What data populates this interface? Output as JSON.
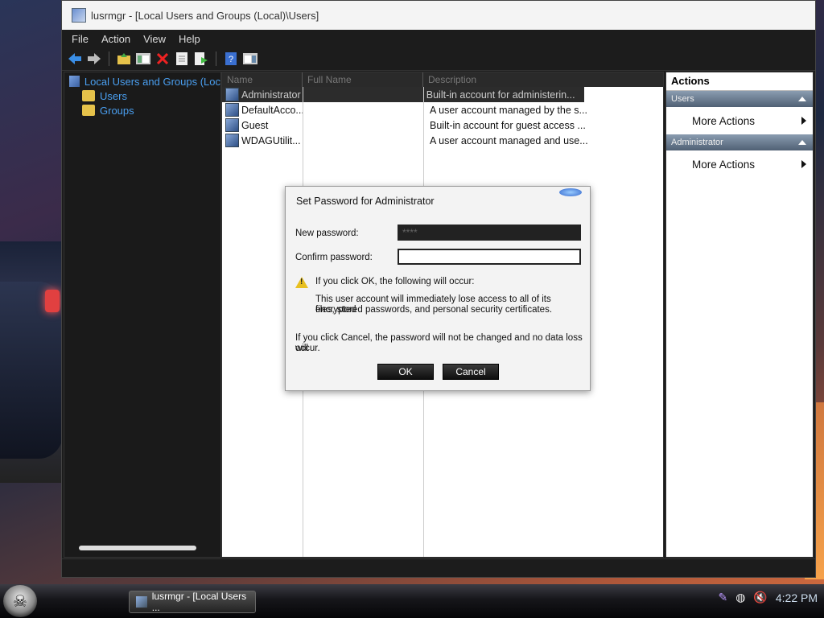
{
  "window": {
    "title": "lusrmgr - [Local Users and Groups (Local)\\Users]"
  },
  "menu": [
    "File",
    "Action",
    "View",
    "Help"
  ],
  "toolbar_icons": [
    "back-arrow-icon",
    "forward-arrow-icon",
    "up-folder-icon",
    "show-hide-tree-icon",
    "delete-icon",
    "properties-icon",
    "export-icon",
    "help-icon",
    "show-action-pane-icon"
  ],
  "tree": {
    "root": "Local Users and Groups (Loc",
    "items": [
      "Users",
      "Groups"
    ]
  },
  "list": {
    "columns": [
      "Name",
      "Full Name",
      "Description"
    ],
    "rows": [
      {
        "name": "Administrator",
        "full_name": "",
        "description": "Built-in account for administerin..."
      },
      {
        "name": "DefaultAcco...",
        "full_name": "",
        "description": "A user account managed by the s..."
      },
      {
        "name": "Guest",
        "full_name": "",
        "description": "Built-in account for guest access ..."
      },
      {
        "name": "WDAGUtilit...",
        "full_name": "",
        "description": "A user account managed and use..."
      }
    ]
  },
  "actions": {
    "title": "Actions",
    "sections": [
      {
        "header": "Users",
        "item": "More Actions"
      },
      {
        "header": "Administrator",
        "item": "More Actions"
      }
    ]
  },
  "dialog": {
    "title": "Set Password for Administrator",
    "new_password_label": "New password:",
    "new_password_value": "****",
    "confirm_password_label": "Confirm password:",
    "confirm_password_value": "",
    "warning_heading": "If you click OK, the following will occur:",
    "warning_line1": "This user account will immediately lose access to all of its encrypted",
    "warning_line2": "files, stored passwords, and personal security certificates.",
    "cancel_note_line1": "If you click Cancel, the password will not be changed and no data loss will",
    "cancel_note_line2": "occur.",
    "ok_label": "OK",
    "cancel_label": "Cancel"
  },
  "taskbar": {
    "task_label": "lusrmgr - [Local Users ...",
    "clock": "4:22 PM"
  }
}
